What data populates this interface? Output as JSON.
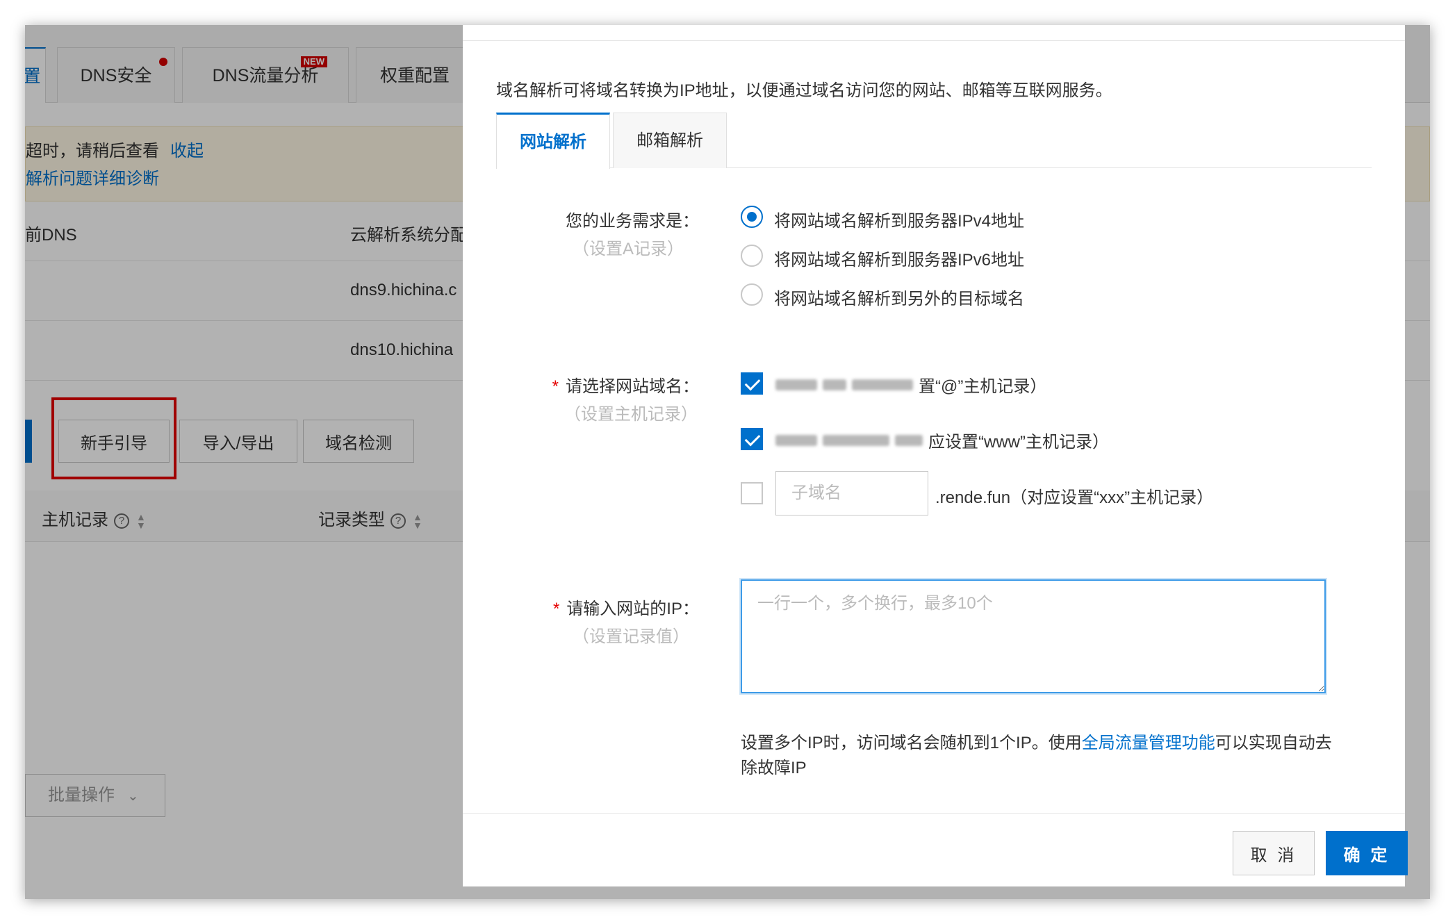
{
  "background": {
    "tabs": [
      {
        "label": "置"
      },
      {
        "label": "DNS安全"
      },
      {
        "label": "DNS流量分析",
        "badge": "NEW"
      },
      {
        "label": "权重配置"
      }
    ],
    "notice": {
      "line1": "超时，请稍后查看",
      "collapse_link": "收起",
      "line2": "解析问题详细诊断"
    },
    "dns_table": {
      "col_current": "前DNS",
      "col_assigned": "云解析系统分配",
      "rows": [
        "dns9.hichina.c",
        "dns10.hichina"
      ]
    },
    "buttons": {
      "guide": "新手引导",
      "import_export": "导入/导出",
      "domain_check": "域名检测"
    },
    "record_table": {
      "col_host": "主机记录",
      "col_type": "记录类型"
    },
    "batch": "批量操作"
  },
  "dialog": {
    "intro": "域名解析可将域名转换为IP地址，以便通过域名访问您的网站、邮箱等互联网服务。",
    "tabs": [
      "网站解析",
      "邮箱解析"
    ],
    "need": {
      "label": "您的业务需求是：",
      "sub": "（设置A记录）",
      "options": [
        "将网站域名解析到服务器IPv4地址",
        "将网站域名解析到服务器IPv6地址",
        "将网站域名解析到另外的目标域名"
      ]
    },
    "domain": {
      "label": "请选择网站域名：",
      "sub": "（设置主机记录）",
      "option1_suffix": "置“@”主机记录）",
      "option2_suffix": "应设置“www”主机记录）",
      "subdomain_placeholder": "子域名",
      "subdomain_suffix": ".rende.fun（对应设置“xxx”主机记录）"
    },
    "ip": {
      "label": "请输入网站的IP：",
      "sub": "（设置记录值）",
      "placeholder": "一行一个，多个换行，最多10个"
    },
    "hint": {
      "before": "设置多个IP时，访问域名会随机到1个IP。使用",
      "link": "全局流量管理功能",
      "after": "可以实现自动去除故障IP"
    },
    "cancel": "取 消",
    "ok": "确 定"
  }
}
